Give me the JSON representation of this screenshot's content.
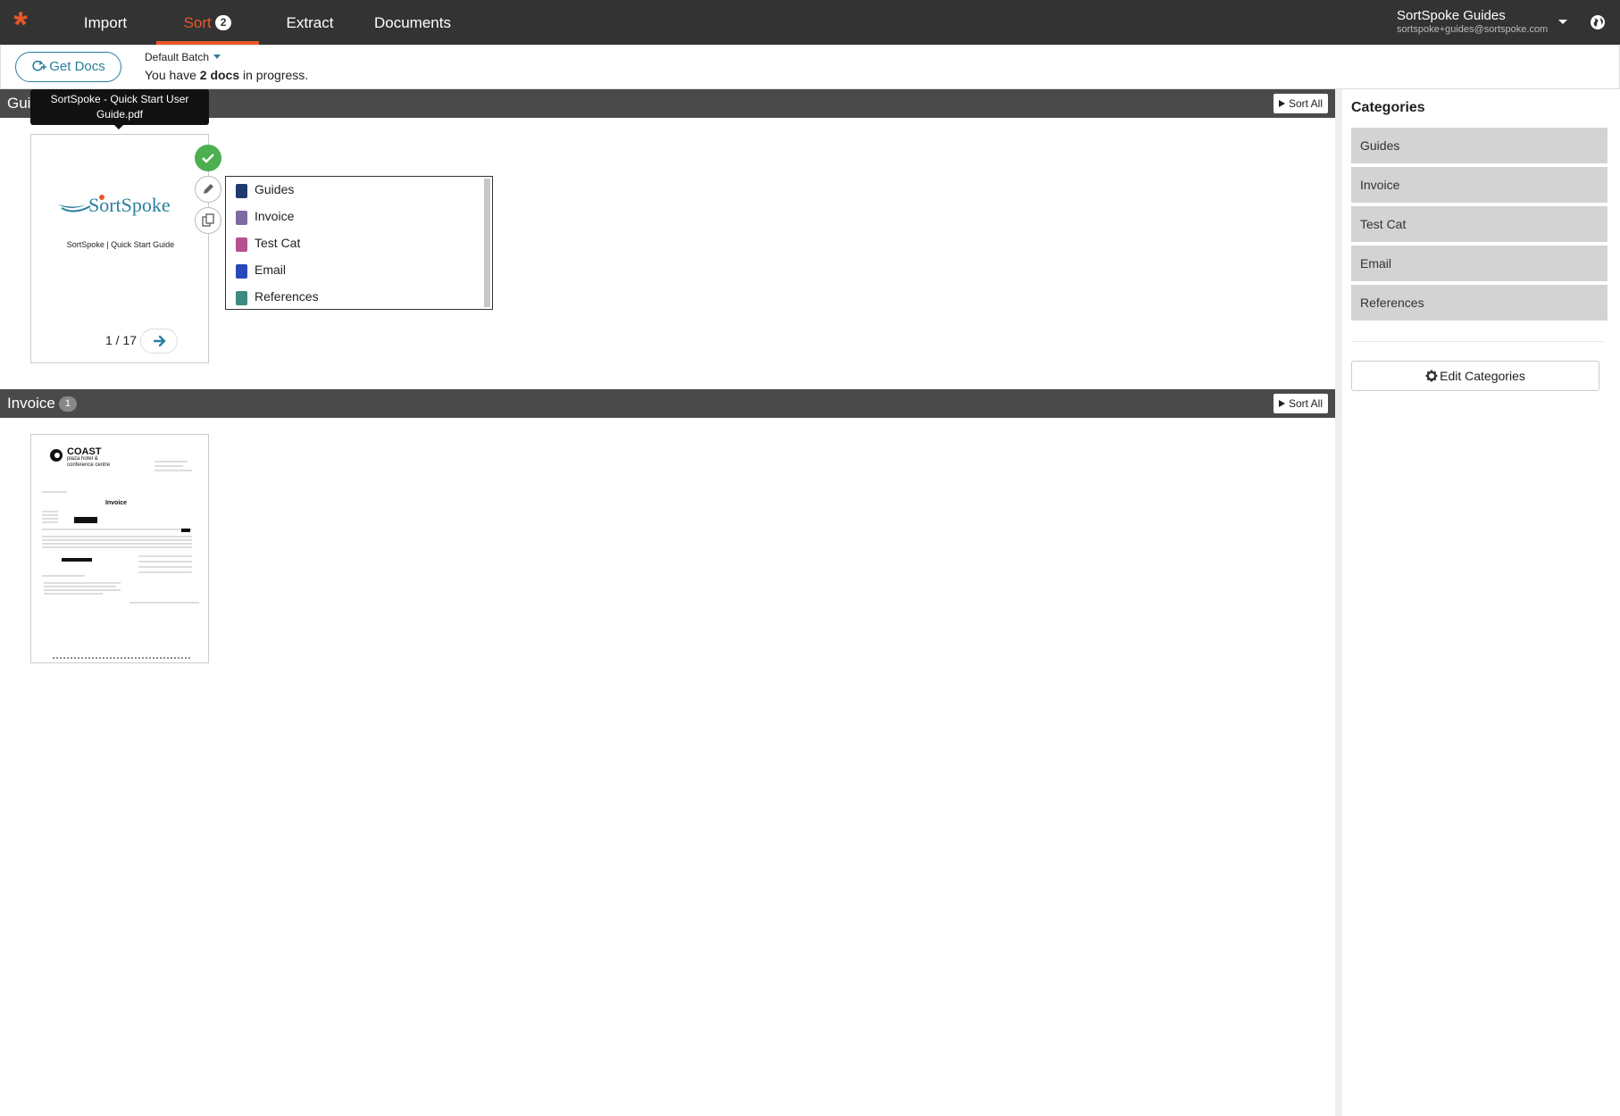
{
  "nav": {
    "tabs": [
      {
        "label": "Import"
      },
      {
        "label": "Sort",
        "badge": "2",
        "active": true
      },
      {
        "label": "Extract"
      },
      {
        "label": "Documents"
      }
    ],
    "user_name": "SortSpoke Guides",
    "user_email": "sortspoke+guides@sortspoke.com",
    "accent_color": "#e8562a"
  },
  "subheader": {
    "get_docs_label": "Get Docs",
    "batch_label": "Default Batch",
    "progress_prefix": "You have",
    "progress_count": "2 docs",
    "progress_suffix": "in progress."
  },
  "groups": [
    {
      "title": "Guides",
      "count": "",
      "sort_all_label": "Sort All",
      "doc": {
        "tooltip": "SortSpoke - Quick Start User Guide.pdf",
        "thumb_logo": "SortSpoke",
        "thumb_caption": "SortSpoke | Quick Start Guide",
        "page_indicator": "1 / 17"
      }
    },
    {
      "title": "Invoice",
      "count": "1",
      "sort_all_label": "Sort All",
      "doc": {
        "thumb_brand": "COAST",
        "thumb_brand_sub1": "plaza hotel &",
        "thumb_brand_sub2": "conference centre",
        "thumb_heading": "Invoice"
      }
    }
  ],
  "category_menu": [
    {
      "label": "Guides",
      "color": "#1f3b6e"
    },
    {
      "label": "Invoice",
      "color": "#7e6aa3"
    },
    {
      "label": "Test Cat",
      "color": "#b5508f"
    },
    {
      "label": "Email",
      "color": "#2749b8"
    },
    {
      "label": "References",
      "color": "#3d8a80"
    }
  ],
  "sidebar": {
    "title": "Categories",
    "categories": [
      {
        "label": "Guides"
      },
      {
        "label": "Invoice"
      },
      {
        "label": "Test Cat"
      },
      {
        "label": "Email"
      },
      {
        "label": "References"
      }
    ],
    "edit_label": "Edit Categories"
  }
}
